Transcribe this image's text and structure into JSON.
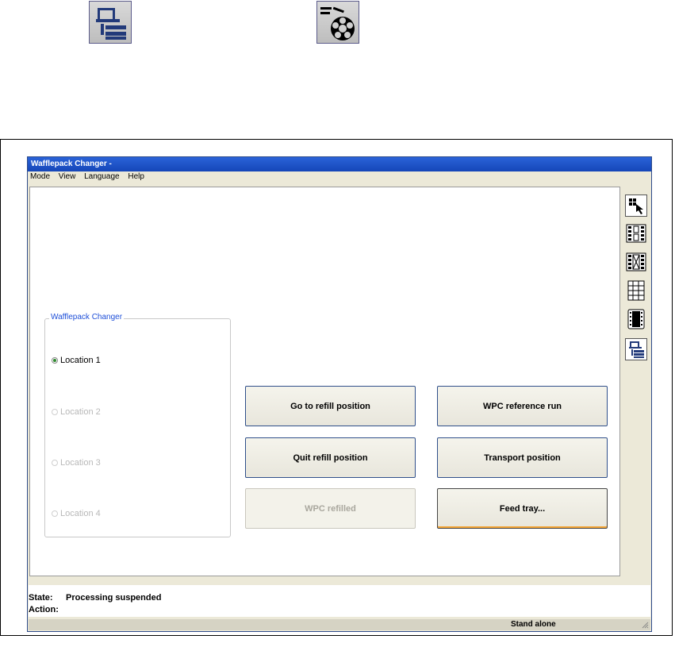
{
  "window": {
    "title": "Wafflepack Changer -",
    "menu": [
      "Mode",
      "View",
      "Language",
      "Help"
    ]
  },
  "toolbar": {
    "items": [
      {
        "icon": "pick-arrow-icon",
        "active": true
      },
      {
        "icon": "grid-layout-icon",
        "active": false
      },
      {
        "icon": "crossed-grid-icon",
        "active": false
      },
      {
        "icon": "tray-grid-icon",
        "active": false
      },
      {
        "icon": "film-strip-icon",
        "active": false
      },
      {
        "icon": "wafflepack-changer-icon",
        "active": true
      }
    ]
  },
  "top_icons": [
    "wafflepack-changer-icon",
    "feeder-reel-icon"
  ],
  "group": {
    "title": "Wafflepack Changer",
    "locations": [
      {
        "label": "Location 1",
        "checked": true,
        "enabled": true
      },
      {
        "label": "Location 2",
        "checked": false,
        "enabled": false
      },
      {
        "label": "Location 3",
        "checked": false,
        "enabled": false
      },
      {
        "label": "Location 4",
        "checked": false,
        "enabled": false
      }
    ]
  },
  "buttons": {
    "go_refill": "Go to refill position",
    "quit_refill": "Quit refill position",
    "wpc_refilled": "WPC refilled",
    "reference_run": "WPC reference run",
    "transport": "Transport position",
    "feed_tray": "Feed tray..."
  },
  "status": {
    "state_label": "State:",
    "state_value": "Processing suspended",
    "action_label": "Action:",
    "action_value": "",
    "bar_text": "Stand alone"
  }
}
